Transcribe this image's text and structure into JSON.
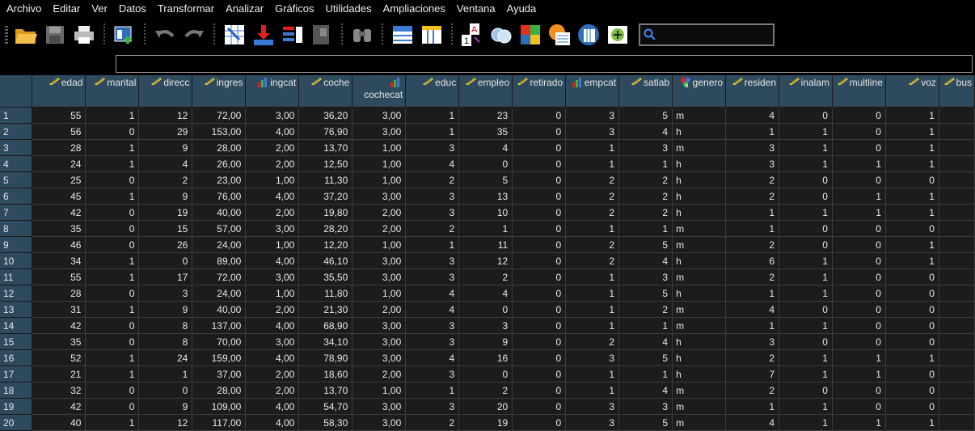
{
  "menu": [
    "Archivo",
    "Editar",
    "Ver",
    "Datos",
    "Transformar",
    "Analizar",
    "Gráficos",
    "Utilidades",
    "Ampliaciones",
    "Ventana",
    "Ayuda"
  ],
  "columns": [
    {
      "label": "edad",
      "icon": "ruler-icon"
    },
    {
      "label": "marital",
      "icon": "ruler-icon"
    },
    {
      "label": "direcc",
      "icon": "ruler-icon"
    },
    {
      "label": "ingres",
      "icon": "ruler-icon"
    },
    {
      "label": "ingcat",
      "icon": "bar-chart-icon"
    },
    {
      "label": "coche",
      "icon": "ruler-icon"
    },
    {
      "label": "cochecat",
      "icon": "bar-chart-icon"
    },
    {
      "label": "educ",
      "icon": "ruler-icon"
    },
    {
      "label": "empleo",
      "icon": "ruler-icon"
    },
    {
      "label": "retirado",
      "icon": "ruler-icon"
    },
    {
      "label": "empcat",
      "icon": "bar-chart-icon"
    },
    {
      "label": "satlab",
      "icon": "ruler-icon"
    },
    {
      "label": "genero",
      "icon": "nominal-icon"
    },
    {
      "label": "residen",
      "icon": "ruler-icon"
    },
    {
      "label": "inalam",
      "icon": "ruler-icon"
    },
    {
      "label": "multline",
      "icon": "ruler-icon"
    },
    {
      "label": "voz",
      "icon": "ruler-icon"
    },
    {
      "label": "bus",
      "icon": "ruler-icon"
    }
  ],
  "rows": [
    [
      "1",
      "55",
      "1",
      "12",
      "72,00",
      "3,00",
      "36,20",
      "3,00",
      "1",
      "23",
      "0",
      "3",
      "5",
      "m",
      "4",
      "0",
      "0",
      "1",
      ""
    ],
    [
      "2",
      "56",
      "0",
      "29",
      "153,00",
      "4,00",
      "76,90",
      "3,00",
      "1",
      "35",
      "0",
      "3",
      "4",
      "h",
      "1",
      "1",
      "0",
      "1",
      ""
    ],
    [
      "3",
      "28",
      "1",
      "9",
      "28,00",
      "2,00",
      "13,70",
      "1,00",
      "3",
      "4",
      "0",
      "1",
      "3",
      "m",
      "3",
      "1",
      "0",
      "1",
      ""
    ],
    [
      "4",
      "24",
      "1",
      "4",
      "26,00",
      "2,00",
      "12,50",
      "1,00",
      "4",
      "0",
      "0",
      "1",
      "1",
      "h",
      "3",
      "1",
      "1",
      "1",
      ""
    ],
    [
      "5",
      "25",
      "0",
      "2",
      "23,00",
      "1,00",
      "11,30",
      "1,00",
      "2",
      "5",
      "0",
      "2",
      "2",
      "h",
      "2",
      "0",
      "0",
      "0",
      ""
    ],
    [
      "6",
      "45",
      "1",
      "9",
      "76,00",
      "4,00",
      "37,20",
      "3,00",
      "3",
      "13",
      "0",
      "2",
      "2",
      "h",
      "2",
      "0",
      "1",
      "1",
      ""
    ],
    [
      "7",
      "42",
      "0",
      "19",
      "40,00",
      "2,00",
      "19,80",
      "2,00",
      "3",
      "10",
      "0",
      "2",
      "2",
      "h",
      "1",
      "1",
      "1",
      "1",
      ""
    ],
    [
      "8",
      "35",
      "0",
      "15",
      "57,00",
      "3,00",
      "28,20",
      "2,00",
      "2",
      "1",
      "0",
      "1",
      "1",
      "m",
      "1",
      "0",
      "0",
      "0",
      ""
    ],
    [
      "9",
      "46",
      "0",
      "26",
      "24,00",
      "1,00",
      "12,20",
      "1,00",
      "1",
      "11",
      "0",
      "2",
      "5",
      "m",
      "2",
      "0",
      "0",
      "1",
      ""
    ],
    [
      "10",
      "34",
      "1",
      "0",
      "89,00",
      "4,00",
      "46,10",
      "3,00",
      "3",
      "12",
      "0",
      "2",
      "4",
      "h",
      "6",
      "1",
      "0",
      "1",
      ""
    ],
    [
      "11",
      "55",
      "1",
      "17",
      "72,00",
      "3,00",
      "35,50",
      "3,00",
      "3",
      "2",
      "0",
      "1",
      "3",
      "m",
      "2",
      "1",
      "0",
      "0",
      ""
    ],
    [
      "12",
      "28",
      "0",
      "3",
      "24,00",
      "1,00",
      "11,80",
      "1,00",
      "4",
      "4",
      "0",
      "1",
      "5",
      "h",
      "1",
      "1",
      "0",
      "0",
      ""
    ],
    [
      "13",
      "31",
      "1",
      "9",
      "40,00",
      "2,00",
      "21,30",
      "2,00",
      "4",
      "0",
      "0",
      "1",
      "2",
      "m",
      "4",
      "0",
      "0",
      "0",
      ""
    ],
    [
      "14",
      "42",
      "0",
      "8",
      "137,00",
      "4,00",
      "68,90",
      "3,00",
      "3",
      "3",
      "0",
      "1",
      "1",
      "m",
      "1",
      "1",
      "0",
      "0",
      ""
    ],
    [
      "15",
      "35",
      "0",
      "8",
      "70,00",
      "3,00",
      "34,10",
      "3,00",
      "3",
      "9",
      "0",
      "2",
      "4",
      "h",
      "3",
      "0",
      "0",
      "0",
      ""
    ],
    [
      "16",
      "52",
      "1",
      "24",
      "159,00",
      "4,00",
      "78,90",
      "3,00",
      "4",
      "16",
      "0",
      "3",
      "5",
      "h",
      "2",
      "1",
      "1",
      "1",
      ""
    ],
    [
      "17",
      "21",
      "1",
      "1",
      "37,00",
      "2,00",
      "18,60",
      "2,00",
      "3",
      "0",
      "0",
      "1",
      "1",
      "h",
      "7",
      "1",
      "1",
      "0",
      ""
    ],
    [
      "18",
      "32",
      "0",
      "0",
      "28,00",
      "2,00",
      "13,70",
      "1,00",
      "1",
      "2",
      "0",
      "1",
      "4",
      "m",
      "2",
      "0",
      "0",
      "0",
      ""
    ],
    [
      "19",
      "42",
      "0",
      "9",
      "109,00",
      "4,00",
      "54,70",
      "3,00",
      "3",
      "20",
      "0",
      "3",
      "3",
      "m",
      "1",
      "1",
      "0",
      "0",
      ""
    ],
    [
      "20",
      "40",
      "1",
      "12",
      "117,00",
      "4,00",
      "58,30",
      "3,00",
      "2",
      "19",
      "0",
      "3",
      "5",
      "m",
      "4",
      "1",
      "1",
      "1",
      ""
    ]
  ]
}
